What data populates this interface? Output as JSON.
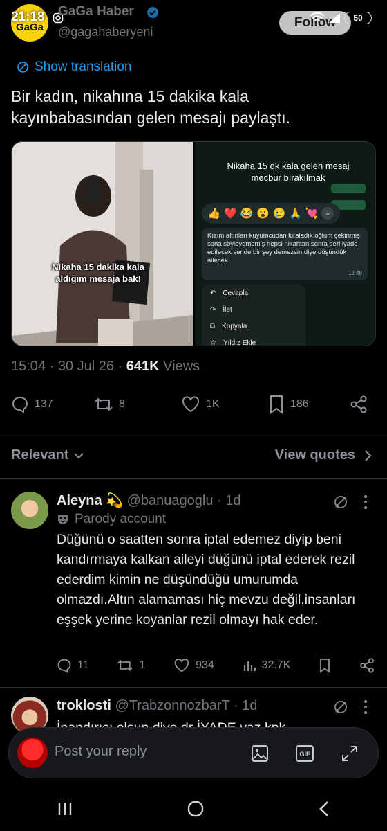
{
  "status": {
    "time": "21:18",
    "battery": "50"
  },
  "author": {
    "name": "GaGa Haber",
    "handle": "@gagahaberyeni",
    "avatar_text": "GaGa",
    "follow_label": "Follow"
  },
  "translate": {
    "label": "Show translation"
  },
  "tweet": {
    "text_line1": "Bir kadın, nikahına 15 dakika kala",
    "text_line2": "kayınbabasından gelen mesajı paylaştı.",
    "timestamp": "15:04 · 30 Jul 26 · ",
    "views_count": "641K",
    "views_label": " Views"
  },
  "media": {
    "left_caption": "Nikaha 15 dakika kala aldığım mesaja bak!",
    "right_caption": "Nikaha 15 dk kala gelen mesaj mecbur bırakılmak",
    "emojis": [
      "👍",
      "❤️",
      "😂",
      "😮",
      "😢",
      "🙏",
      "💘"
    ],
    "message": "Kızım altınları kuyumcudan kiraladık oğlum çekinmiş sana söyleyememiş hepsi nikahtan sonra geri iyade edilecek sende bir şey demezsin diye düşündük ailecek",
    "message_time": "12:48",
    "menu": [
      "Cevapla",
      "İlet",
      "Kopyala",
      "Yıldız Ekle"
    ]
  },
  "actions": {
    "replies": "137",
    "reposts": "8",
    "likes": "1K",
    "bookmarks": "186"
  },
  "filters": {
    "relevant": "Relevant",
    "view_quotes": "View quotes"
  },
  "replies": [
    {
      "name": "Aleyna",
      "emoji": "💫",
      "handle": "@banuagoglu",
      "time": " · 1d",
      "badge": "Parody account",
      "text": "Düğünü o saatten sonra iptal edemez diyip beni kandırmaya kalkan aileyi düğünü iptal ederek rezil ederdim kimin ne düşündüğü umurumda olmazdı.Altın alamaması hiç mevzu değil,insanları eşşek yerine koyanlar rezil olmayı hak eder.",
      "stats": {
        "replies": "11",
        "reposts": "1",
        "likes": "934",
        "views": "32.7K"
      }
    },
    {
      "name": "troklosti",
      "handle": "@TrabzonnozbarT",
      "time": " · 1d",
      "text_partial": "İnandırıcı olsun diye dr İYADE yaz knk"
    }
  ],
  "composer": {
    "placeholder": "Post your reply"
  },
  "colors": {
    "accent": "#1d9bf0",
    "background": "#000000",
    "muted": "#71767b"
  }
}
